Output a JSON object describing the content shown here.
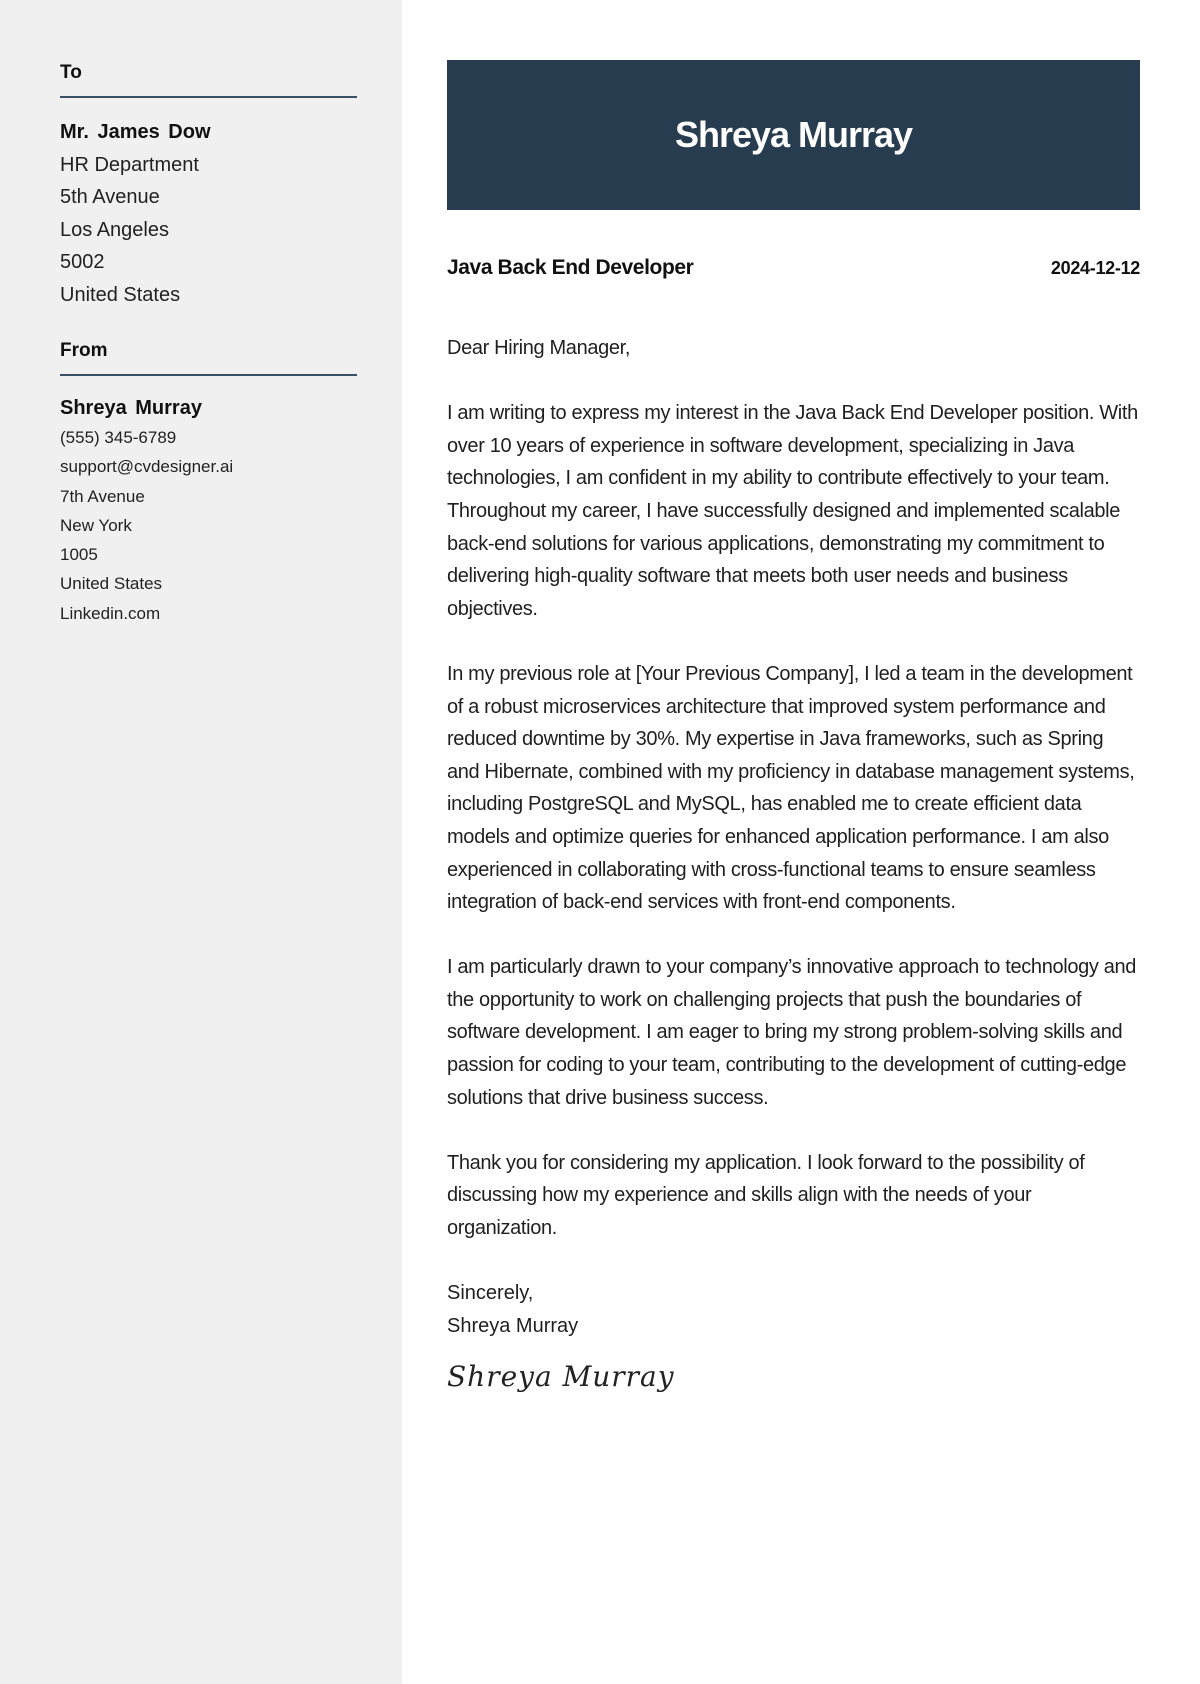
{
  "sidebar": {
    "to": {
      "heading": "To",
      "name": "Mr. James Dow",
      "lines": [
        "HR Department",
        "5th Avenue",
        "Los Angeles",
        "5002",
        "United States"
      ]
    },
    "from": {
      "heading": "From",
      "name": "Shreya Murray",
      "lines": [
        "(555) 345-6789",
        "support@cvdesigner.ai",
        "7th Avenue",
        "New York",
        "1005",
        "United States",
        "Linkedin.com"
      ]
    }
  },
  "header": {
    "name": "Shreya Murray",
    "background_color": "#283c50"
  },
  "letter": {
    "job_title": "Java Back End Developer",
    "date": "2024-12-12",
    "salutation": "Dear Hiring Manager,",
    "paragraphs": [
      "I am writing to express my interest in the Java Back End Developer position. With over 10 years of experience in software development, specializing in Java technologies, I am confident in my ability to contribute effectively to your team. Throughout my career, I have successfully designed and implemented scalable back-end solutions for various applications, demonstrating my commitment to delivering high-quality software that meets both user needs and business objectives.",
      "In my previous role at [Your Previous Company], I led a team in the development of a robust microservices architecture that improved system performance and reduced downtime by 30%. My expertise in Java frameworks, such as Spring and Hibernate, combined with my proficiency in database management systems, including PostgreSQL and MySQL, has enabled me to create efficient data models and optimize queries for enhanced application performance. I am also experienced in collaborating with cross-functional teams to ensure seamless integration of back-end services with front-end components.",
      "I am particularly drawn to your company’s innovative approach to technology and the opportunity to work on challenging projects that push the boundaries of software development. I am eager to bring my strong problem-solving skills and passion for coding to your team, contributing to the development of cutting-edge solutions that drive business success.",
      "Thank you for considering my application. I look forward to the possibility of discussing how my experience and skills align with the needs of your organization."
    ],
    "closing": "Sincerely,",
    "closing_name": "Shreya Murray",
    "signature": "Shreya Murray"
  }
}
